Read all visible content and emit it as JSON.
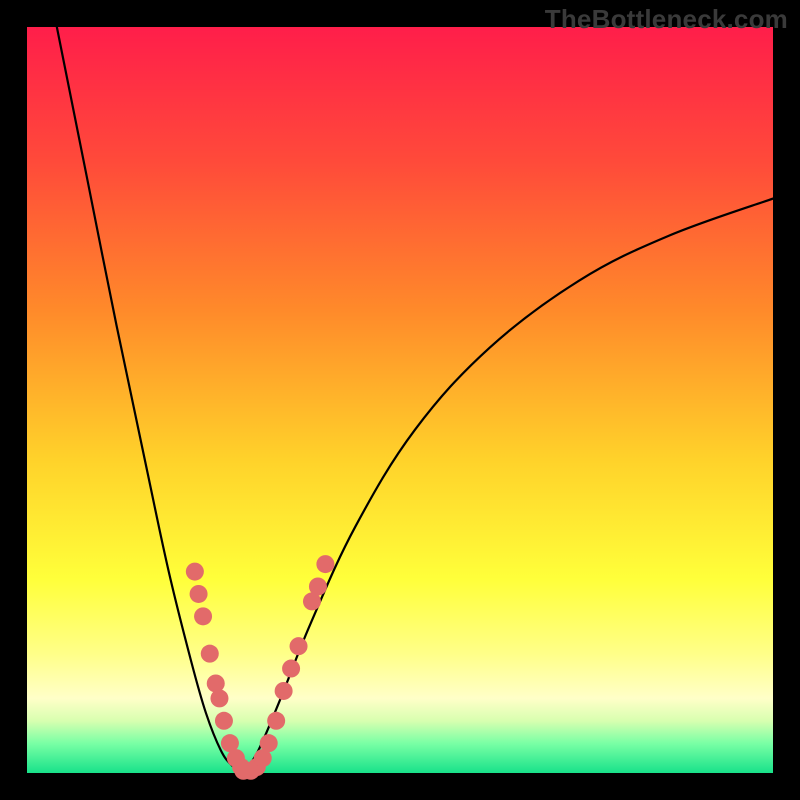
{
  "watermark": "TheBottleneck.com",
  "colors": {
    "frame": "#000000",
    "gradient_stops": [
      {
        "pct": 0,
        "color": "#ff1e4a"
      },
      {
        "pct": 18,
        "color": "#ff4a3a"
      },
      {
        "pct": 38,
        "color": "#ff8a2a"
      },
      {
        "pct": 58,
        "color": "#ffd22a"
      },
      {
        "pct": 74,
        "color": "#ffff3a"
      },
      {
        "pct": 84,
        "color": "#ffff88"
      },
      {
        "pct": 90,
        "color": "#ffffc8"
      },
      {
        "pct": 93,
        "color": "#d8ffb0"
      },
      {
        "pct": 96,
        "color": "#7affa5"
      },
      {
        "pct": 100,
        "color": "#18e28a"
      }
    ],
    "curve": "#000000",
    "marker_fill": "#e26a6a",
    "marker_stroke": "#c94f4f"
  },
  "chart_data": {
    "type": "line",
    "title": "",
    "xlabel": "",
    "ylabel": "",
    "xlim": [
      0,
      100
    ],
    "ylim": [
      0,
      100
    ],
    "note": "V-shaped bottleneck curve. y is mismatch magnitude (0 at optimum). Left branch is steep/near-linear descent; right branch rises with diminishing slope. Minimum near x≈29. Axis values estimated from pixel positions; no tick labels present.",
    "series": [
      {
        "name": "left-branch",
        "x": [
          4,
          8,
          12,
          16,
          19,
          22,
          24,
          26,
          27.5,
          29
        ],
        "y": [
          100,
          80,
          60,
          41,
          27,
          15,
          8,
          3,
          1,
          0
        ]
      },
      {
        "name": "right-branch",
        "x": [
          29,
          31,
          34,
          38,
          44,
          52,
          62,
          74,
          86,
          100
        ],
        "y": [
          0,
          3,
          10,
          20,
          33,
          46,
          57,
          66,
          72,
          77
        ]
      }
    ],
    "markers": {
      "name": "sample-points",
      "comment": "Salmon dots clustered around the V bottom along both branches.",
      "points": [
        {
          "x": 22.5,
          "y": 27
        },
        {
          "x": 23.0,
          "y": 24
        },
        {
          "x": 23.6,
          "y": 21
        },
        {
          "x": 24.5,
          "y": 16
        },
        {
          "x": 25.3,
          "y": 12
        },
        {
          "x": 25.8,
          "y": 10
        },
        {
          "x": 26.4,
          "y": 7
        },
        {
          "x": 27.2,
          "y": 4
        },
        {
          "x": 28.0,
          "y": 2
        },
        {
          "x": 28.7,
          "y": 0.8
        },
        {
          "x": 29.0,
          "y": 0.3
        },
        {
          "x": 30.0,
          "y": 0.3
        },
        {
          "x": 30.8,
          "y": 0.8
        },
        {
          "x": 31.6,
          "y": 2
        },
        {
          "x": 32.4,
          "y": 4
        },
        {
          "x": 33.4,
          "y": 7
        },
        {
          "x": 34.4,
          "y": 11
        },
        {
          "x": 35.4,
          "y": 14
        },
        {
          "x": 36.4,
          "y": 17
        },
        {
          "x": 38.2,
          "y": 23
        },
        {
          "x": 39.0,
          "y": 25
        },
        {
          "x": 40.0,
          "y": 28
        }
      ]
    }
  }
}
